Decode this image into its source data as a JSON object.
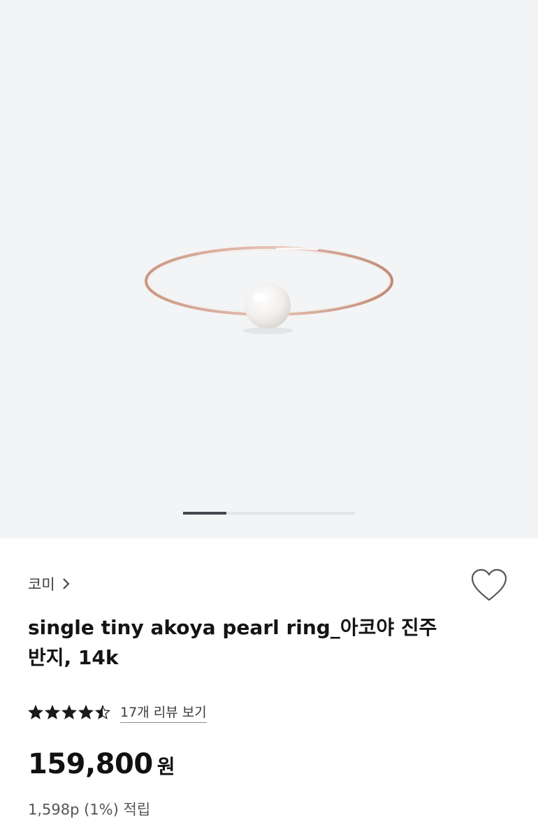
{
  "gallery": {
    "image_subject": "rose gold ring with single pearl",
    "current_slide_fraction": 0.25
  },
  "product": {
    "brand": "코미",
    "title": "single tiny akoya pearl ring_아코야 진주 반지, 14k",
    "rating": 4.5,
    "review_link": "17개 리뷰 보기",
    "price": "159,800",
    "currency": "원",
    "points": "1,598p (1%) 적립"
  },
  "icons": {
    "brand_chevron": "chevron-right-icon",
    "wishlist": "heart-outline-icon",
    "rating": "star-icon"
  },
  "colors": {
    "gallery_bg": "#f3f4f6",
    "star": "#1a1a1a",
    "pager_active": "#44474d"
  }
}
